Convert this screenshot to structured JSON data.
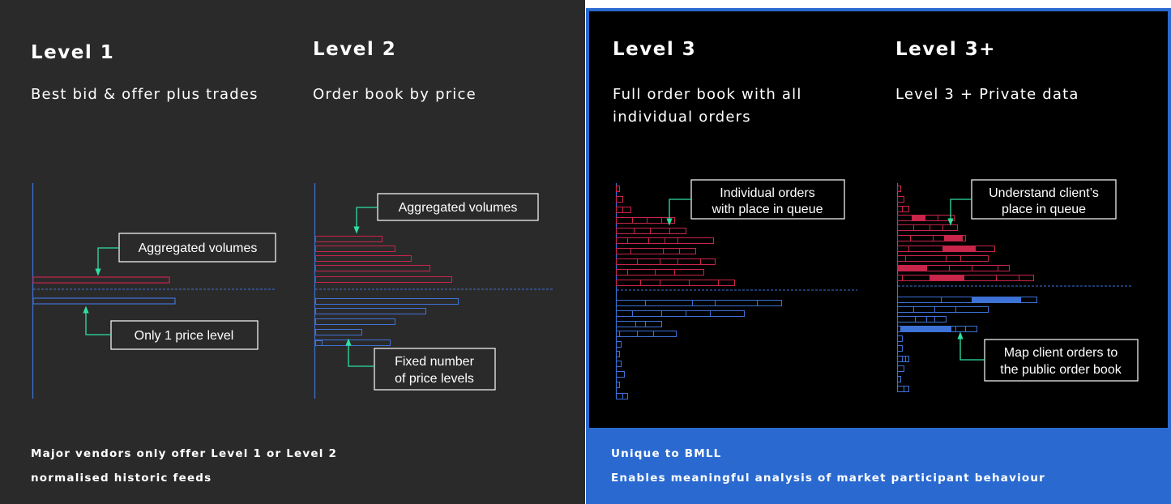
{
  "levels": [
    {
      "title": "Level 1",
      "subtitle": "Best bid & offer plus trades"
    },
    {
      "title": "Level 2",
      "subtitle": "Order book by price"
    },
    {
      "title": "Level 3",
      "subtitle_lines": [
        "Full order book with all",
        "individual orders"
      ]
    },
    {
      "title": "Level 3+",
      "subtitle": "Level 3 + Private data"
    }
  ],
  "callouts": {
    "l1_top": "Aggregated volumes",
    "l1_bottom": "Only 1 price level",
    "l2_top": "Aggregated volumes",
    "l2_bottom": [
      "Fixed number",
      "of price levels"
    ],
    "l3_top": [
      "Individual orders",
      "with place in queue"
    ],
    "l3p_top": [
      "Understand client’s",
      "place in queue"
    ],
    "l3p_bottom": [
      "Map client orders to",
      "the public order book"
    ]
  },
  "footer_left": [
    "Major vendors only offer Level 1 or Level 2",
    "normalised historic feeds"
  ],
  "footer_right": [
    "Unique to BMLL",
    "Enables meaningful analysis of market participant behaviour"
  ],
  "colors": {
    "ask": "#c8254a",
    "bid": "#3d72d6",
    "accent": "#2fe0a0",
    "left_bg": "#2b2a2b",
    "right_bg": "#2a6ad0",
    "inner_bg": "#000000"
  }
}
